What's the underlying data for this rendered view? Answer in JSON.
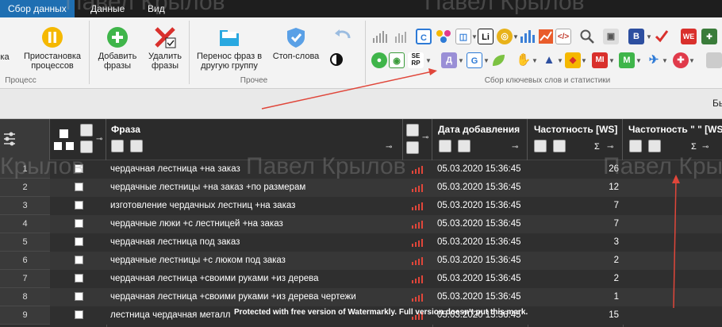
{
  "tabs": [
    "Сбор данных",
    "Данные",
    "Вид"
  ],
  "ribbon": {
    "partial_label": "ка",
    "pause_label": "Приостановка процессов",
    "add_label": "Добавить фразы",
    "delete_label": "Удалить фразы",
    "move_label": "Перенос фраз в другую группу",
    "stopwords_label": "Стоп-слова",
    "group_process": "Процесс",
    "group_other": "Прочее",
    "group_collect": "Сбор ключевых слов и статистики",
    "tool_d_letter": "Д",
    "tool_g_letter": "G",
    "tool_li_letter": "Li",
    "tool_b_letter": "B",
    "tool_we_letter": "WE",
    "tool_mi_letter": "MI",
    "tool_m_letter": "M"
  },
  "strip": {
    "right_text": "Быс"
  },
  "grid": {
    "col_phrase": "Фраза",
    "col_date": "Дата добавления",
    "col_freq_ws": "Частотность [WS]",
    "col_freq_quote": "Частотность \" \" [WS",
    "sigma": "Σ",
    "rows": [
      {
        "num": "1",
        "phrase": "чердачная лестница +на заказ",
        "date": "05.03.2020 15:36:45",
        "freq": "26"
      },
      {
        "num": "2",
        "phrase": "чердачные лестницы +на заказ +по размерам",
        "date": "05.03.2020 15:36:45",
        "freq": "12"
      },
      {
        "num": "3",
        "phrase": "изготовление чердачных лестниц +на заказ",
        "date": "05.03.2020 15:36:45",
        "freq": "7"
      },
      {
        "num": "4",
        "phrase": "чердачные люки +с лестницей +на заказ",
        "date": "05.03.2020 15:36:45",
        "freq": "7"
      },
      {
        "num": "5",
        "phrase": "чердачная лестница под заказ",
        "date": "05.03.2020 15:36:45",
        "freq": "3"
      },
      {
        "num": "6",
        "phrase": "чердачные лестницы +с люком под заказ",
        "date": "05.03.2020 15:36:45",
        "freq": "2"
      },
      {
        "num": "7",
        "phrase": "чердачная лестница +своими руками +из дерева",
        "date": "05.03.2020 15:36:45",
        "freq": "2"
      },
      {
        "num": "8",
        "phrase": "чердачная лестница +своими руками +из дерева чертежи",
        "date": "05.03.2020 15:36:45",
        "freq": "1"
      },
      {
        "num": "9",
        "phrase": "лестница чердачная металл",
        "date": "05.03.2020 15:36:45",
        "freq": "15"
      }
    ]
  },
  "watermarks": [
    "Павел Крылов",
    "Павел Крылов",
    "Крылов",
    "Павел Крылов",
    "Павел Крылов"
  ],
  "notice": "Protected with free version of Watermarkly. Full version doesn't put this mark.",
  "colors": {
    "tab_active": "#1f6fb2",
    "annotation_arrow": "#e0463a",
    "bars": "#e0463a"
  }
}
